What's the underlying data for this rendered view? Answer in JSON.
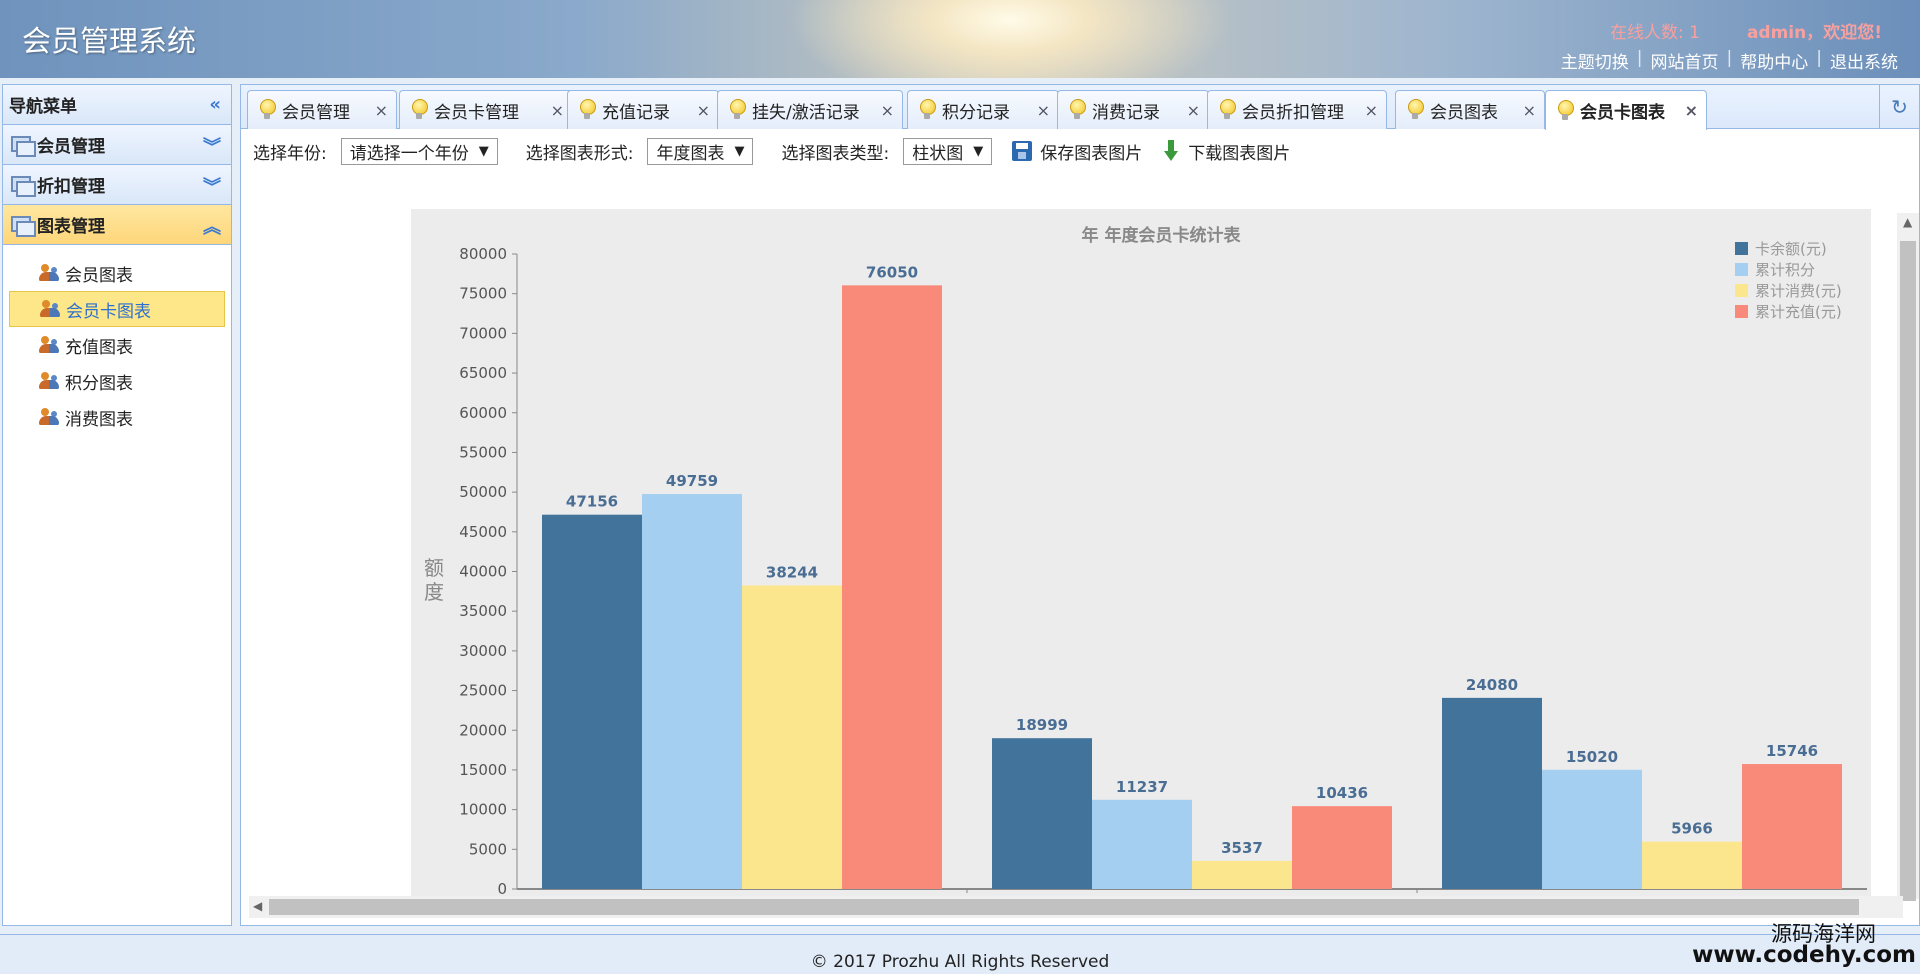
{
  "header": {
    "title": "会员管理系统",
    "online": "在线人数: 1",
    "welcome": "admin，欢迎您!",
    "links": [
      "主题切换",
      "网站首页",
      "帮助中心",
      "退出系统"
    ]
  },
  "nav": {
    "title": "导航菜单",
    "sections": [
      {
        "label": "会员管理"
      },
      {
        "label": "折扣管理"
      },
      {
        "label": "图表管理"
      }
    ],
    "items": [
      "会员图表",
      "会员卡图表",
      "充值图表",
      "积分图表",
      "消费图表"
    ],
    "selected_item": "会员卡图表"
  },
  "tabs": [
    {
      "label": "会员管理"
    },
    {
      "label": "会员卡管理"
    },
    {
      "label": "充值记录"
    },
    {
      "label": "挂失/激活记录"
    },
    {
      "label": "积分记录"
    },
    {
      "label": "消费记录"
    },
    {
      "label": "会员折扣管理"
    },
    {
      "label": "会员图表"
    },
    {
      "label": "会员卡图表"
    }
  ],
  "active_tab": "会员卡图表",
  "toolbar": {
    "year_label": "选择年份:",
    "year_value": "请选择一个年份",
    "form_label": "选择图表形式:",
    "form_value": "年度图表",
    "type_label": "选择图表类型:",
    "type_value": "柱状图",
    "save_label": "保存图表图片",
    "download_label": "下载图表图片"
  },
  "chart_data": {
    "type": "bar",
    "title": "年 年度会员卡统计表",
    "ylabel": "额\n度",
    "xlabel": "",
    "ylim": [
      0,
      80000
    ],
    "yticks": [
      0,
      5000,
      10000,
      15000,
      20000,
      25000,
      30000,
      35000,
      40000,
      45000,
      50000,
      55000,
      60000,
      65000,
      70000,
      75000,
      80000
    ],
    "categories": [
      "",
      "",
      ""
    ],
    "legend_position": "top-right",
    "series": [
      {
        "name": "卡余额(元)",
        "color": "#41739b",
        "values": [
          47156,
          18999,
          24080
        ]
      },
      {
        "name": "累计积分",
        "color": "#a4cff0",
        "values": [
          49759,
          11237,
          15020
        ]
      },
      {
        "name": "累计消费(元)",
        "color": "#fce68d",
        "values": [
          38244,
          3537,
          5966
        ]
      },
      {
        "name": "累计充值(元)",
        "color": "#f98a7a",
        "values": [
          76050,
          10436,
          15746
        ]
      }
    ]
  },
  "footer": {
    "copyright": "© 2017 Prozhu All Rights Reserved"
  },
  "watermark": {
    "line1": "源码海洋网",
    "line2": "www.codehy.com"
  }
}
